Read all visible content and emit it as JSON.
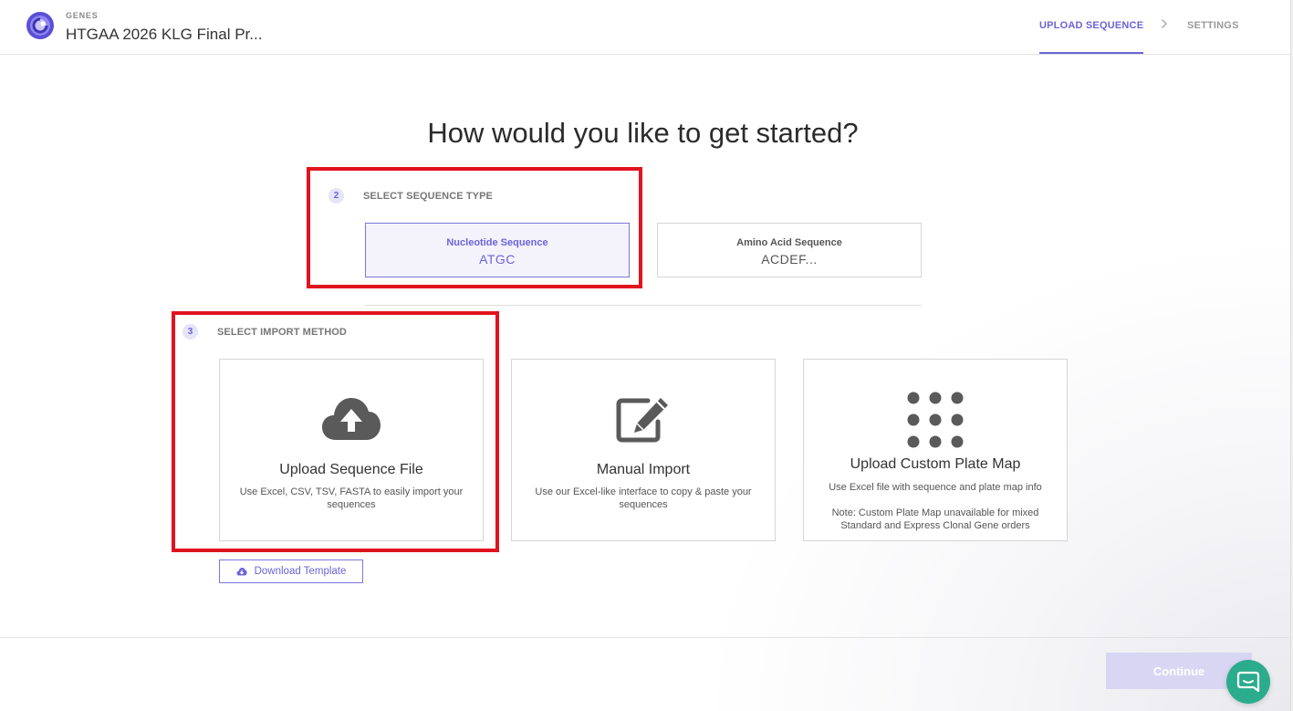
{
  "header": {
    "app_label": "GENES",
    "project_title": "HTGAA 2026 KLG Final Pr...",
    "steps": [
      {
        "label": "UPLOAD SEQUENCE",
        "active": true
      },
      {
        "label": "SETTINGS",
        "active": false
      }
    ],
    "step_separator": ">"
  },
  "main": {
    "heading": "How would you like to get started?",
    "sequence_type": {
      "step_number": "2",
      "title": "SELECT SEQUENCE TYPE",
      "options": [
        {
          "name": "Nucleotide Sequence",
          "value": "ATGC",
          "selected": true
        },
        {
          "name": "Amino Acid Sequence",
          "value": "ACDEF...",
          "selected": false
        }
      ]
    },
    "import_method": {
      "step_number": "3",
      "title": "SELECT IMPORT METHOD",
      "options": [
        {
          "icon": "cloud-upload-icon",
          "title": "Upload Sequence File",
          "description": "Use Excel, CSV, TSV, FASTA to easily import your sequences"
        },
        {
          "icon": "edit-icon",
          "title": "Manual Import",
          "description": "Use our Excel-like interface to copy & paste your sequences"
        },
        {
          "icon": "grid-dots-icon",
          "title": "Upload Custom Plate Map",
          "description": "Use Excel file with sequence and plate map info",
          "note": "Note: Custom Plate Map unavailable for mixed Standard and Express Clonal Gene orders"
        }
      ],
      "download_template_label": "Download Template"
    }
  },
  "footer": {
    "continue_label": "Continue",
    "continue_enabled": false
  },
  "colors": {
    "accent": "#6c63d8",
    "highlight": "#e0131e",
    "chat": "#2bac8c",
    "continue_disabled": "#d9d6f3"
  }
}
